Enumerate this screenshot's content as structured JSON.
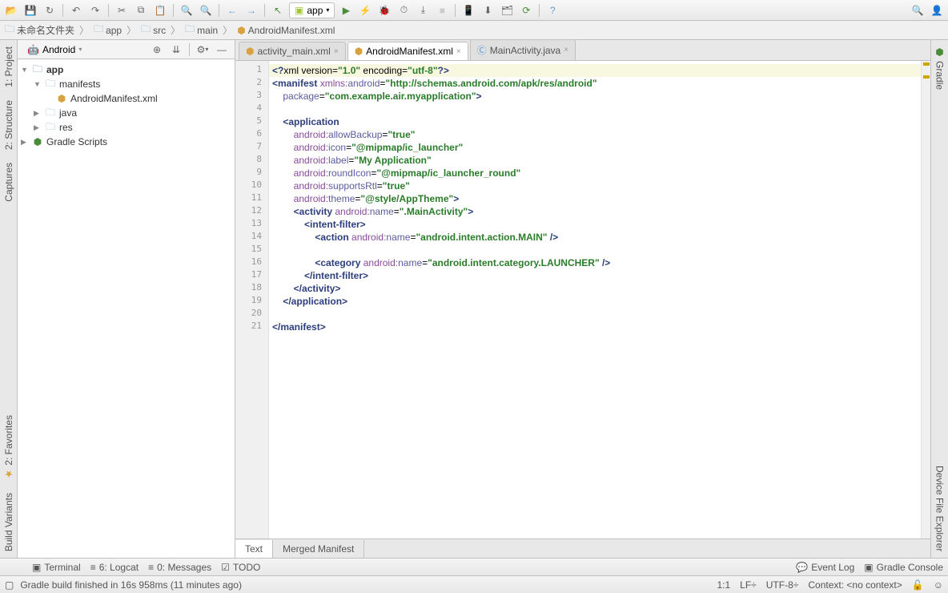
{
  "toolbar": {
    "run_config_label": "app"
  },
  "breadcrumb": {
    "items": [
      "未命名文件夹",
      "app",
      "src",
      "main",
      "AndroidManifest.xml"
    ]
  },
  "project_header": {
    "view_label": "Android"
  },
  "tree": {
    "root": "app",
    "items": [
      {
        "label": "manifests",
        "type": "folder"
      },
      {
        "label": "AndroidManifest.xml",
        "type": "xml",
        "indent": 2
      },
      {
        "label": "java",
        "type": "folder"
      },
      {
        "label": "res",
        "type": "folder"
      }
    ],
    "gradle": "Gradle Scripts"
  },
  "tabs": [
    {
      "label": "activity_main.xml",
      "active": false,
      "icon": "layout"
    },
    {
      "label": "AndroidManifest.xml",
      "active": true,
      "icon": "xml"
    },
    {
      "label": "MainActivity.java",
      "active": false,
      "icon": "class"
    }
  ],
  "code_lines": [
    {
      "n": 1,
      "seg": [
        [
          "c-tag",
          "<?"
        ],
        [
          "c-txt",
          "xml version="
        ],
        [
          "c-val",
          "\"1.0\""
        ],
        [
          "c-txt",
          " encoding="
        ],
        [
          "c-val",
          "\"utf-8\""
        ],
        [
          "c-tag",
          "?>"
        ]
      ],
      "hl": true
    },
    {
      "n": 2,
      "seg": [
        [
          "c-tag",
          "<manifest "
        ],
        [
          "c-ns",
          "xmlns:"
        ],
        [
          "c-attr",
          "android"
        ],
        [
          "c-txt",
          "="
        ],
        [
          "c-val",
          "\"http://schemas.android.com/apk/res/android\""
        ]
      ]
    },
    {
      "n": 3,
      "seg": [
        [
          "c-txt",
          "    "
        ],
        [
          "c-attr",
          "package"
        ],
        [
          "c-txt",
          "="
        ],
        [
          "c-val",
          "\"com.example.air.myapplication\""
        ],
        [
          "c-tag",
          ">"
        ]
      ]
    },
    {
      "n": 4,
      "seg": []
    },
    {
      "n": 5,
      "seg": [
        [
          "c-txt",
          "    "
        ],
        [
          "c-tag",
          "<application"
        ]
      ]
    },
    {
      "n": 6,
      "seg": [
        [
          "c-txt",
          "        "
        ],
        [
          "c-ns",
          "android:"
        ],
        [
          "c-attr",
          "allowBackup"
        ],
        [
          "c-txt",
          "="
        ],
        [
          "c-val",
          "\"true\""
        ]
      ]
    },
    {
      "n": 7,
      "seg": [
        [
          "c-txt",
          "        "
        ],
        [
          "c-ns",
          "android:"
        ],
        [
          "c-attr",
          "icon"
        ],
        [
          "c-txt",
          "="
        ],
        [
          "c-val",
          "\"@mipmap/ic_launcher\""
        ]
      ]
    },
    {
      "n": 8,
      "seg": [
        [
          "c-txt",
          "        "
        ],
        [
          "c-ns",
          "android:"
        ],
        [
          "c-attr",
          "label"
        ],
        [
          "c-txt",
          "="
        ],
        [
          "c-val",
          "\"My Application\""
        ]
      ]
    },
    {
      "n": 9,
      "seg": [
        [
          "c-txt",
          "        "
        ],
        [
          "c-ns",
          "android:"
        ],
        [
          "c-attr",
          "roundIcon"
        ],
        [
          "c-txt",
          "="
        ],
        [
          "c-val",
          "\"@mipmap/ic_launcher_round\""
        ]
      ]
    },
    {
      "n": 10,
      "seg": [
        [
          "c-txt",
          "        "
        ],
        [
          "c-ns",
          "android:"
        ],
        [
          "c-attr",
          "supportsRtl"
        ],
        [
          "c-txt",
          "="
        ],
        [
          "c-val",
          "\"true\""
        ]
      ]
    },
    {
      "n": 11,
      "seg": [
        [
          "c-txt",
          "        "
        ],
        [
          "c-ns",
          "android:"
        ],
        [
          "c-attr",
          "theme"
        ],
        [
          "c-txt",
          "="
        ],
        [
          "c-val",
          "\"@style/AppTheme\""
        ],
        [
          "c-tag",
          ">"
        ]
      ]
    },
    {
      "n": 12,
      "seg": [
        [
          "c-txt",
          "        "
        ],
        [
          "c-tag",
          "<activity "
        ],
        [
          "c-ns",
          "android:"
        ],
        [
          "c-attr",
          "name"
        ],
        [
          "c-txt",
          "="
        ],
        [
          "c-val",
          "\".MainActivity\""
        ],
        [
          "c-tag",
          ">"
        ]
      ]
    },
    {
      "n": 13,
      "seg": [
        [
          "c-txt",
          "            "
        ],
        [
          "c-tag",
          "<intent-filter>"
        ]
      ]
    },
    {
      "n": 14,
      "seg": [
        [
          "c-txt",
          "                "
        ],
        [
          "c-tag",
          "<action "
        ],
        [
          "c-ns",
          "android:"
        ],
        [
          "c-attr",
          "name"
        ],
        [
          "c-txt",
          "="
        ],
        [
          "c-val",
          "\"android.intent.action.MAIN\""
        ],
        [
          "c-tag",
          " />"
        ]
      ]
    },
    {
      "n": 15,
      "seg": []
    },
    {
      "n": 16,
      "seg": [
        [
          "c-txt",
          "                "
        ],
        [
          "c-tag",
          "<category "
        ],
        [
          "c-ns",
          "android:"
        ],
        [
          "c-attr",
          "name"
        ],
        [
          "c-txt",
          "="
        ],
        [
          "c-val",
          "\"android.intent.category.LAUNCHER\""
        ],
        [
          "c-tag",
          " />"
        ]
      ]
    },
    {
      "n": 17,
      "seg": [
        [
          "c-txt",
          "            "
        ],
        [
          "c-tag",
          "</intent-filter>"
        ]
      ]
    },
    {
      "n": 18,
      "seg": [
        [
          "c-txt",
          "        "
        ],
        [
          "c-tag",
          "</activity>"
        ]
      ]
    },
    {
      "n": 19,
      "seg": [
        [
          "c-txt",
          "    "
        ],
        [
          "c-tag",
          "</application>"
        ]
      ]
    },
    {
      "n": 20,
      "seg": []
    },
    {
      "n": 21,
      "seg": [
        [
          "c-tag",
          "</manifest>"
        ]
      ]
    }
  ],
  "editor_footer": {
    "tabs": [
      "Text",
      "Merged Manifest"
    ]
  },
  "left_tabs": [
    "1: Project",
    "2: Structure",
    "Captures",
    "2: Favorites",
    "Build Variants"
  ],
  "right_tabs": [
    "Gradle",
    "Device File Explorer"
  ],
  "bottom": {
    "terminal": "Terminal",
    "logcat": "6: Logcat",
    "messages": "0: Messages",
    "todo": "TODO",
    "event_log": "Event Log",
    "gradle_console": "Gradle Console"
  },
  "status": {
    "msg": "Gradle build finished in 16s 958ms (11 minutes ago)",
    "pos": "1:1",
    "lf": "LF÷",
    "enc": "UTF-8÷",
    "ctx": "Context: <no context>"
  }
}
